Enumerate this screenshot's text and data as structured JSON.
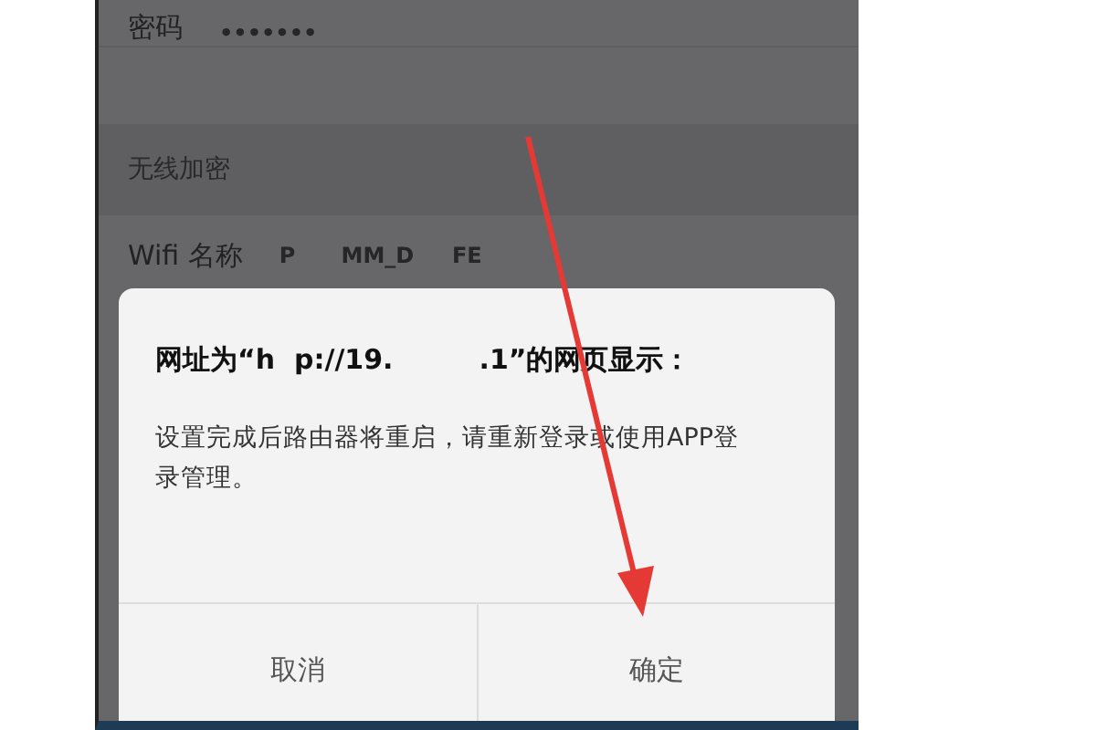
{
  "settings": [
    {
      "kind": "field",
      "label": "密码",
      "value": "•••••••"
    },
    {
      "kind": "blank"
    },
    {
      "kind": "section",
      "label": "无线加密"
    },
    {
      "kind": "field",
      "label": "Wifi 名称",
      "value": "P      MM_D     FE"
    }
  ],
  "dialog": {
    "title": "网址为“h  p://19.         .1”的网页显示：",
    "message": "设置完成后路由器将重启，请重新登录或使用APP登录管理。",
    "buttons": [
      "取消",
      "确定"
    ]
  }
}
